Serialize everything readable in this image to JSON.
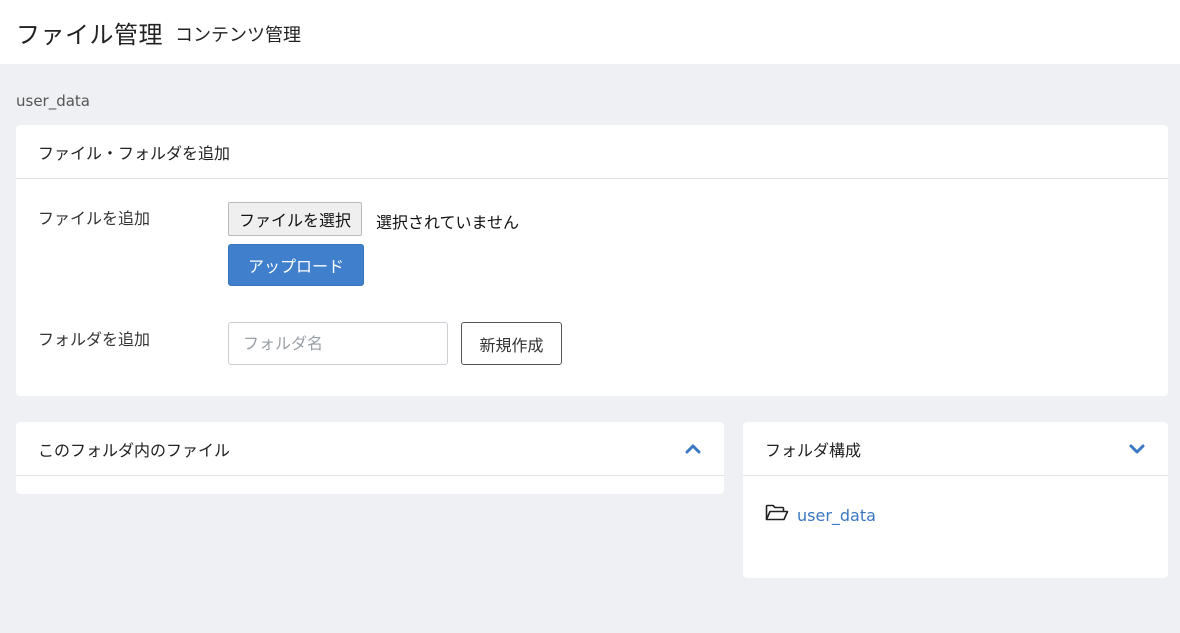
{
  "header": {
    "title": "ファイル管理",
    "subtitle": "コンテンツ管理"
  },
  "breadcrumb": "user_data",
  "add_panel": {
    "title": "ファイル・フォルダを追加",
    "file_label": "ファイルを追加",
    "file_button": "ファイルを選択",
    "file_status": "選択されていません",
    "upload_button": "アップロード",
    "folder_label": "フォルダを追加",
    "folder_placeholder": "フォルダ名",
    "folder_value": "",
    "create_button": "新規作成"
  },
  "files_panel": {
    "title": "このフォルダ内のファイル",
    "icon": "chevron-up-icon"
  },
  "tree_panel": {
    "title": "フォルダ構成",
    "icon": "chevron-down-icon",
    "items": [
      {
        "label": "user_data",
        "icon": "folder-open-icon"
      }
    ]
  },
  "colors": {
    "accent": "#3f7fcc",
    "link": "#3a78c2",
    "background": "#eef0f3"
  }
}
